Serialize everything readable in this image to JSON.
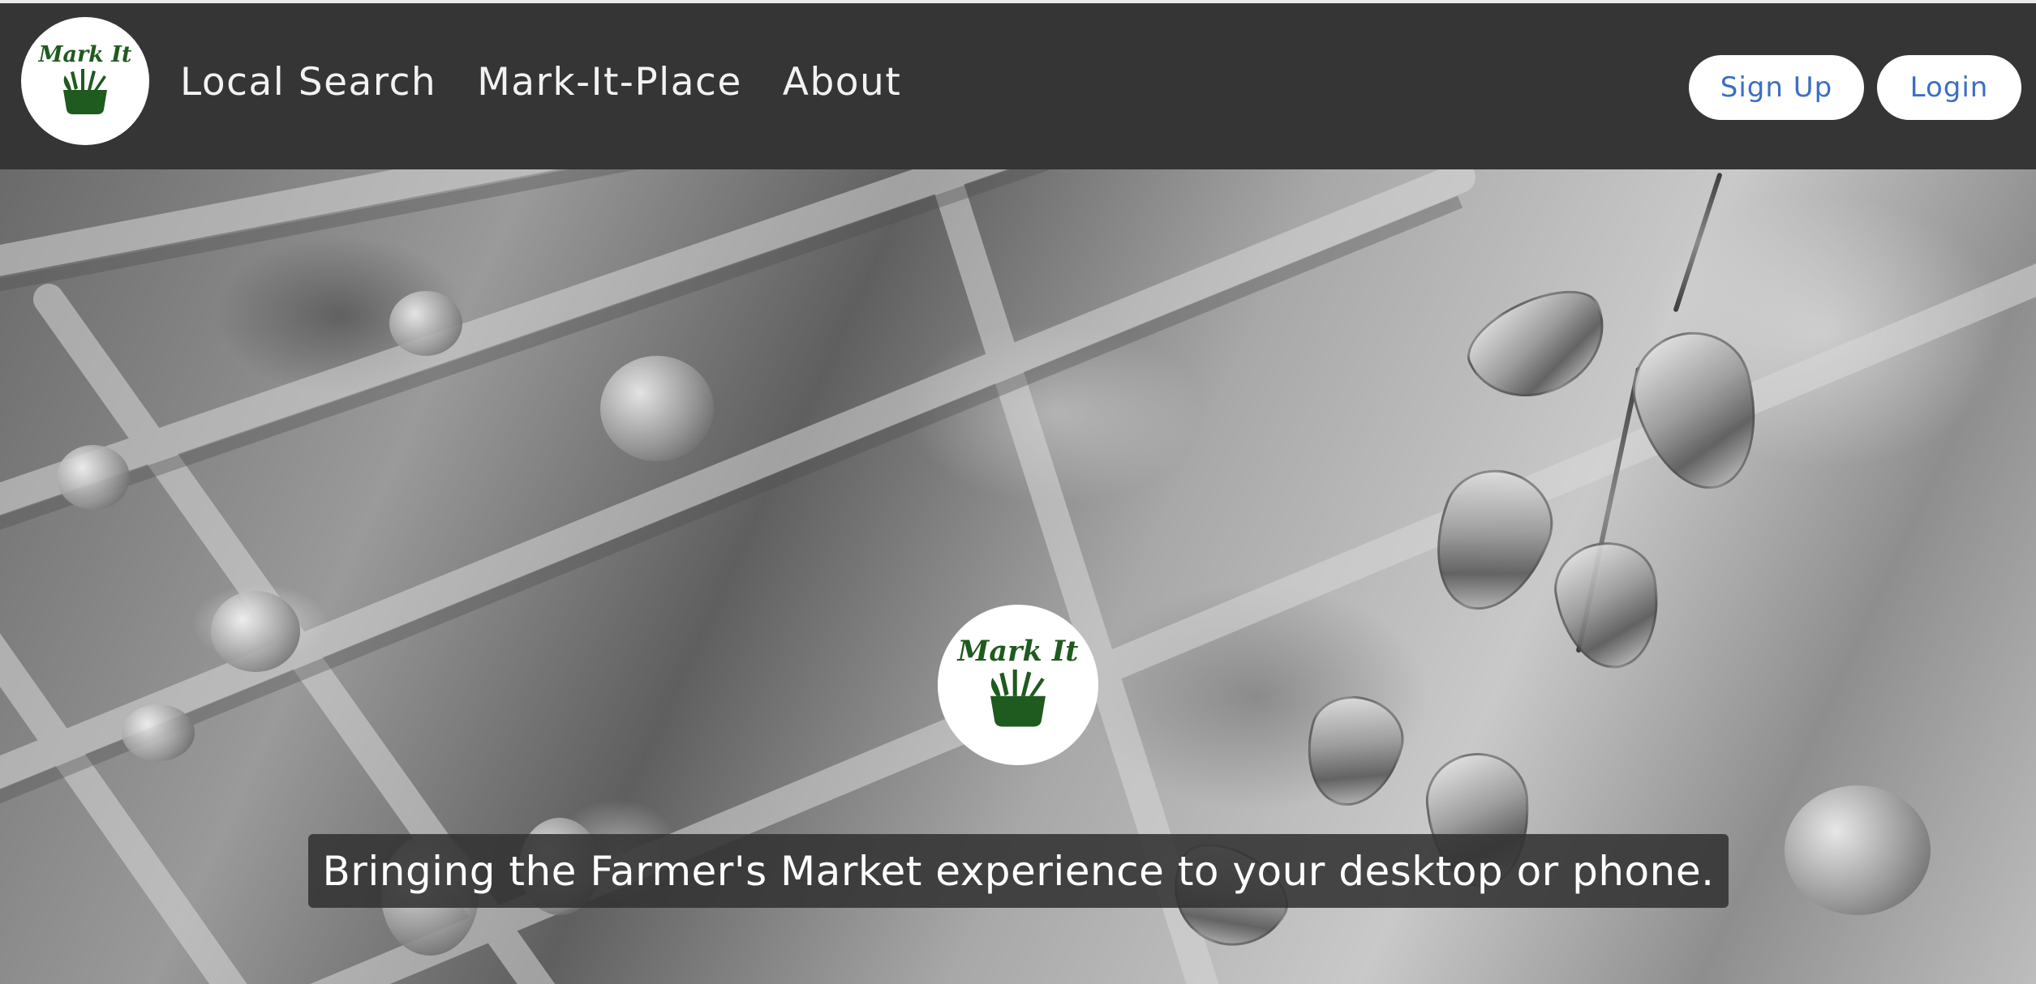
{
  "brand": {
    "logo_text": "Mark It",
    "logo_icon": "basket-of-vegetables-icon",
    "logo_color": "#1f5a1f"
  },
  "nav": {
    "links": [
      {
        "label": "Local Search"
      },
      {
        "label": "Mark-It-Place"
      },
      {
        "label": "About"
      }
    ],
    "background": "#353535"
  },
  "auth": {
    "signup_label": "Sign Up",
    "login_label": "Login",
    "button_text_color": "#3a6fc4"
  },
  "hero": {
    "background_image": "grayscale-jewelry-tray-photo",
    "logo_text": "Mark It",
    "tagline": "Bringing the Farmer's Market experience to your desktop or phone."
  }
}
